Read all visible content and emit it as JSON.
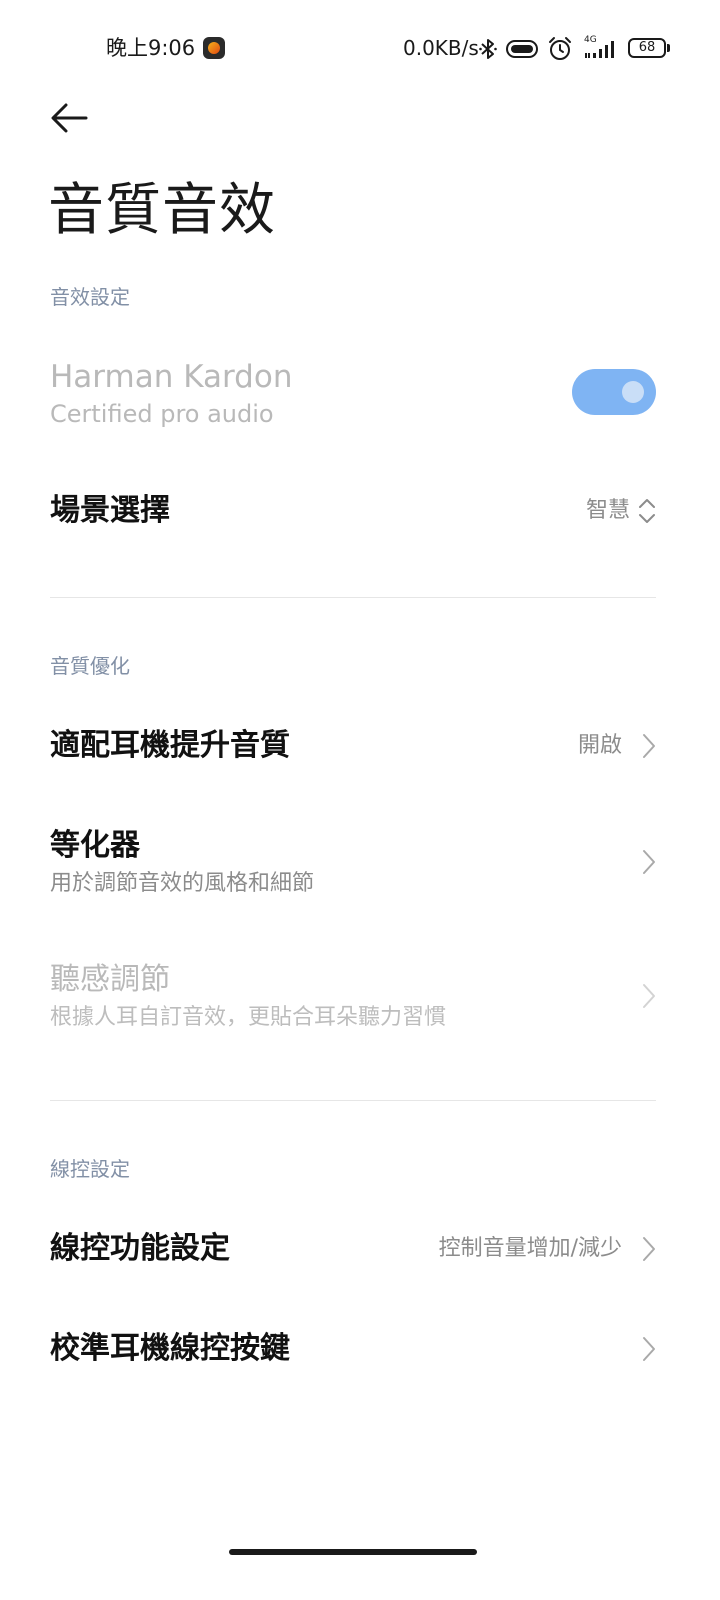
{
  "status_bar": {
    "time": "晚上9:06",
    "net_speed": "0.0KB/s",
    "signal_type": "4G",
    "battery": "68",
    "icons": [
      "bluetooth-icon",
      "vibrate-icon",
      "alarm-icon",
      "signal-icon",
      "battery-icon"
    ]
  },
  "header": {
    "back_icon": "arrow-left-icon",
    "title": "音質音效"
  },
  "sections": {
    "effect_settings": {
      "header": "音效設定",
      "harman": {
        "title": "Harman Kardon",
        "subtitle": "Certified pro audio",
        "toggle_on": true
      },
      "scene": {
        "title": "場景選擇",
        "value": "智慧"
      }
    },
    "quality": {
      "header": "音質優化",
      "adapt": {
        "title": "適配耳機提升音質",
        "value": "開啟"
      },
      "equalizer": {
        "title": "等化器",
        "subtitle": "用於調節音效的風格和細節"
      },
      "hearing": {
        "title": "聽感調節",
        "subtitle": "根據人耳自訂音效，更貼合耳朵聽力習慣"
      }
    },
    "wire_control": {
      "header": "線控設定",
      "function": {
        "title": "線控功能設定",
        "value": "控制音量增加/減少"
      },
      "calibrate": {
        "title": "校準耳機線控按鍵"
      }
    }
  },
  "colors": {
    "accent_toggle": "#7fb4f3",
    "section_header": "#8290a6"
  }
}
